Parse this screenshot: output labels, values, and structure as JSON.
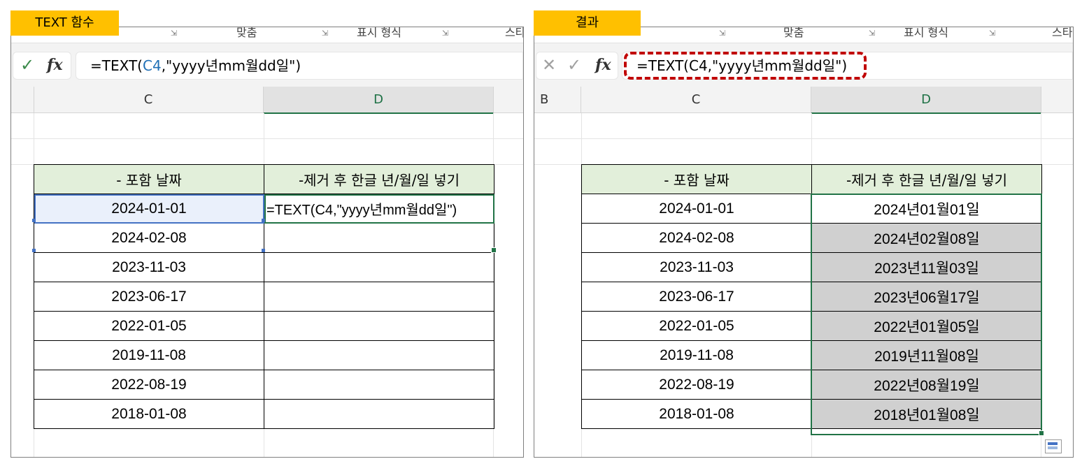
{
  "left": {
    "tag": "TEXT 함수",
    "ribbon": [
      "맞춤",
      "표시 형식",
      "스타"
    ],
    "formula_prefix": "=TEXT(",
    "formula_ref": "C4",
    "formula_suffix": ",\"yyyy년mm월dd일\")",
    "col_c": "C",
    "col_d": "D",
    "header_c": "- 포함 날짜",
    "header_d": "-제거 후 한글 년/월/일 넣기",
    "editing_text": "=TEXT(C4,\"yyyy년mm월dd일\")",
    "dates": [
      "2024-01-01",
      "2024-02-08",
      "2023-11-03",
      "2023-06-17",
      "2022-01-05",
      "2019-11-08",
      "2022-08-19",
      "2018-01-08"
    ]
  },
  "right": {
    "tag": "결과",
    "ribbon": [
      "맞춤",
      "표시 형식",
      "스타"
    ],
    "formula": "=TEXT(C4,\"yyyy년mm월dd일\")",
    "col_b": "B",
    "col_c": "C",
    "col_d": "D",
    "header_c": "- 포함 날짜",
    "header_d": "-제거 후 한글 년/월/일 넣기",
    "dates": [
      "2024-01-01",
      "2024-02-08",
      "2023-11-03",
      "2023-06-17",
      "2022-01-05",
      "2019-11-08",
      "2022-08-19",
      "2018-01-08"
    ],
    "results": [
      "2024년01월01일",
      "2024년02월08일",
      "2023년11월03일",
      "2023년06월17일",
      "2022년01월05일",
      "2019년11월08일",
      "2022년08월19일",
      "2018년01월08일"
    ]
  },
  "colors": {
    "tag": "#ffc000",
    "header_fill": "#e2efda",
    "selection": "#217346",
    "highlight": "#c00000",
    "ref": "#1f6fb5"
  },
  "icons": [
    "confirm-check-icon",
    "fx-icon",
    "cancel-x-icon",
    "resize-launcher-icon",
    "quick-analysis-icon"
  ]
}
